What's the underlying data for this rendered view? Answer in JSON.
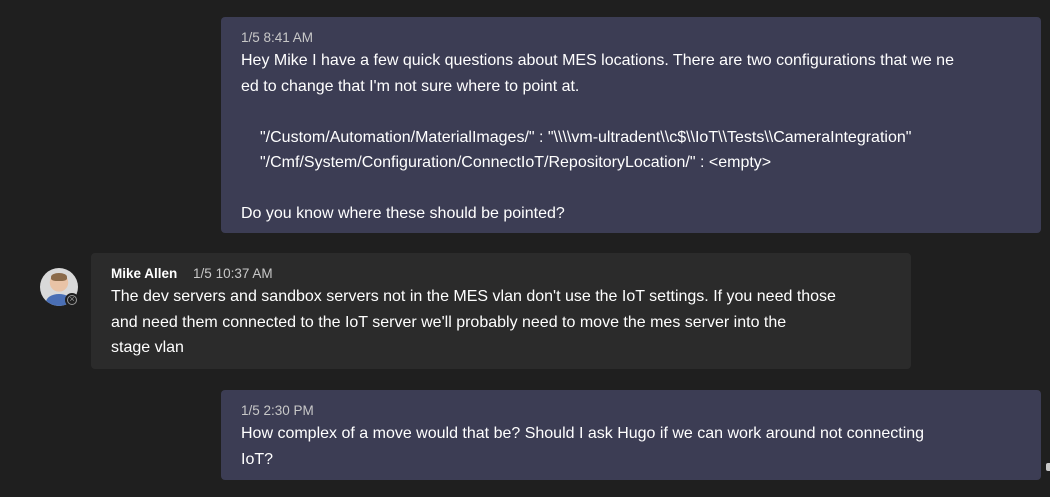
{
  "messages": [
    {
      "timestamp": "1/5 8:41 AM",
      "lines": [
        "Hey Mike I have a few quick questions about MES locations. There are two configurations that we ne",
        "ed to change that I'm not sure where to point at."
      ],
      "config_lines": [
        "\"/Custom/Automation/MaterialImages/\" : \"\\\\\\\\vm-ultradent\\\\c$\\\\IoT\\\\Tests\\\\CameraIntegration\"",
        "\"/Cmf/System/Configuration/ConnectIoT/RepositoryLocation/\" : <empty>"
      ],
      "closing": "Do you know where these should be pointed?"
    },
    {
      "author": "Mike Allen",
      "timestamp": "1/5 10:37 AM",
      "lines": [
        "The dev servers and sandbox servers not in the MES vlan don't use the IoT settings. If you need those",
        "and need them connected to the IoT server we'll probably need to move the mes server into the",
        "stage vlan"
      ],
      "avatar_icon": "user-avatar",
      "status_icon": "offline-status-icon"
    },
    {
      "timestamp": "1/5 2:30 PM",
      "lines": [
        "How complex of a move would that be? Should I ask Hugo if we can work around not connecting",
        "IoT?"
      ]
    }
  ],
  "colors": {
    "background": "#1f1f1f",
    "own_bubble": "#3c3d54",
    "other_bubble": "#2b2b2b",
    "meta_text": "#c8c8c8"
  }
}
